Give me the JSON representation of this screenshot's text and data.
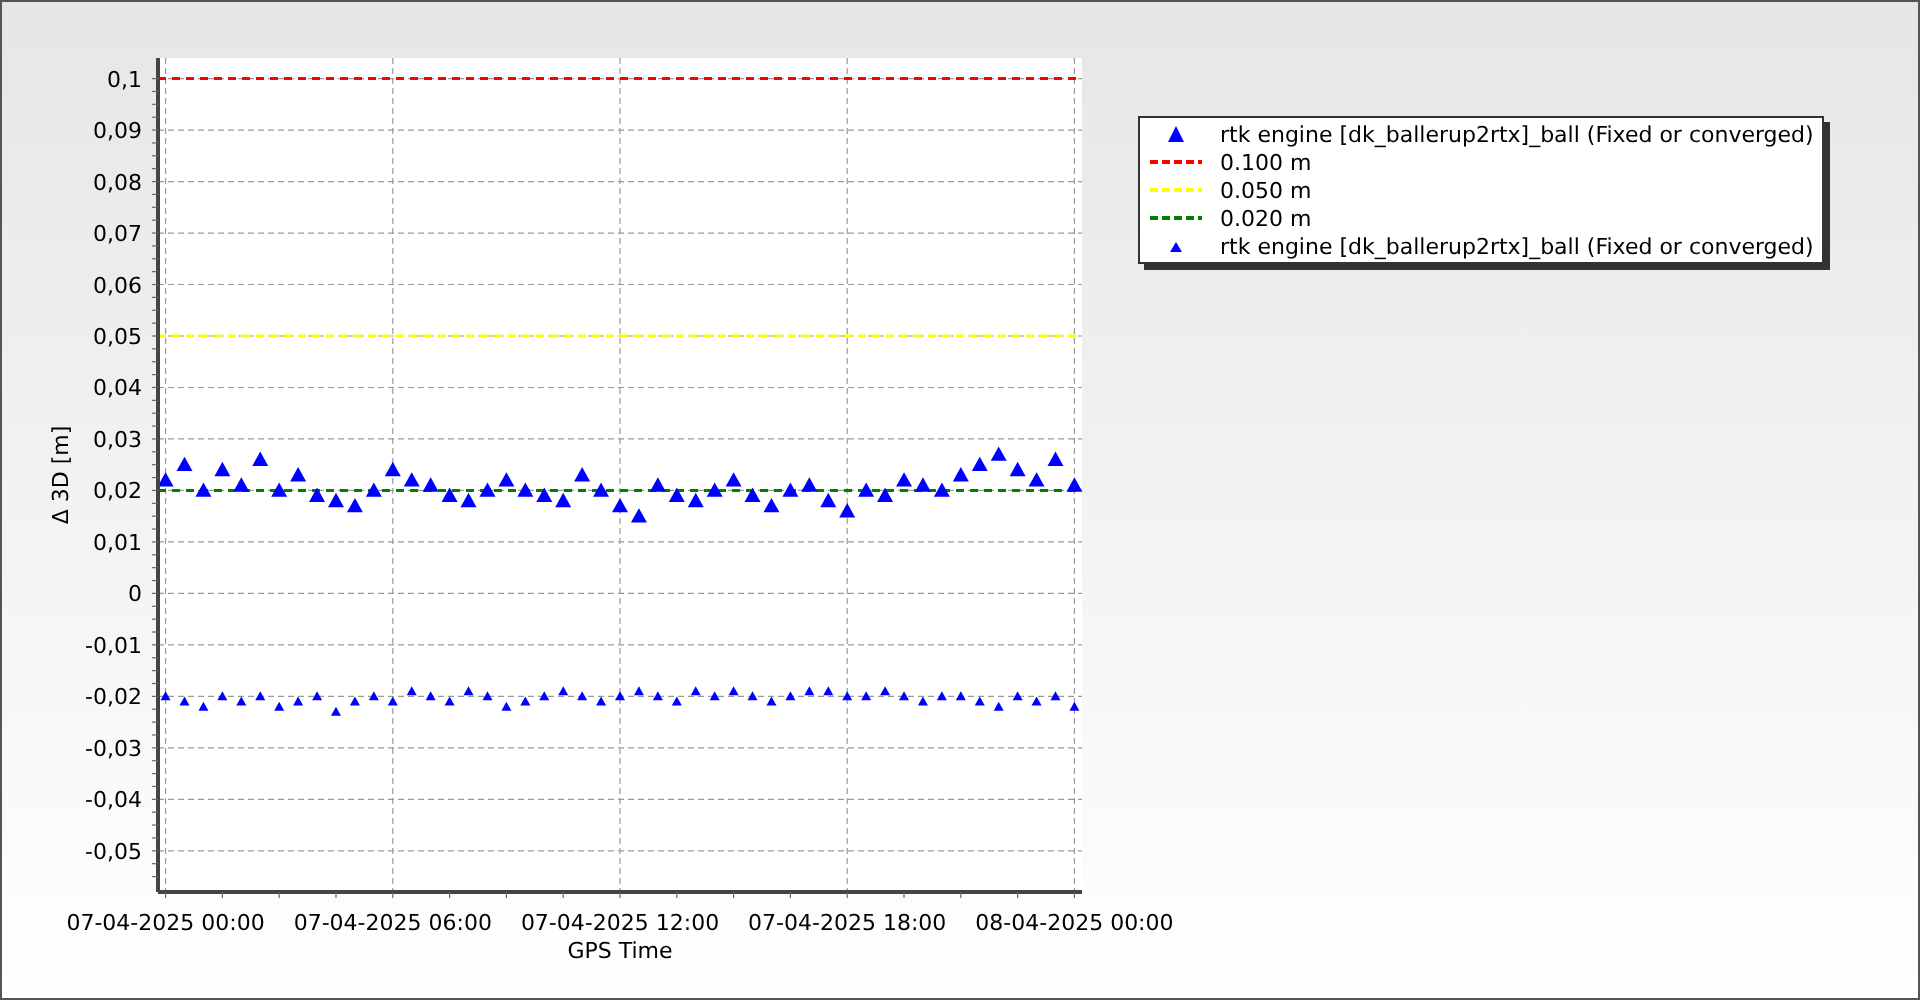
{
  "chart": {
    "chart_data": {
      "type": "scatter",
      "xlabel": "GPS Time",
      "ylabel": "Δ 3D [m]",
      "grid": true,
      "ylim": [
        -0.058,
        0.104
      ],
      "categories": [
        "07-04-2025 00:00",
        null,
        null,
        null,
        null,
        null,
        null,
        null,
        null,
        null,
        null,
        null,
        "07-04-2025 06:00",
        null,
        null,
        null,
        null,
        null,
        null,
        null,
        null,
        null,
        null,
        null,
        "07-04-2025 12:00",
        null,
        null,
        null,
        null,
        null,
        null,
        null,
        null,
        null,
        null,
        null,
        "07-04-2025 18:00",
        null,
        null,
        null,
        null,
        null,
        null,
        null,
        null,
        null,
        null,
        null,
        "08-04-2025 00:00"
      ],
      "yticks": [
        {
          "value": 0.1,
          "label": "0,1"
        },
        {
          "value": 0.09,
          "label": "0,09"
        },
        {
          "value": 0.08,
          "label": "0,08"
        },
        {
          "value": 0.07,
          "label": "0,07"
        },
        {
          "value": 0.06,
          "label": "0,06"
        },
        {
          "value": 0.05,
          "label": "0,05"
        },
        {
          "value": 0.04,
          "label": "0,04"
        },
        {
          "value": 0.03,
          "label": "0,03"
        },
        {
          "value": 0.02,
          "label": "0,02"
        },
        {
          "value": 0.01,
          "label": "0,01"
        },
        {
          "value": 0,
          "label": "0"
        },
        {
          "value": -0.01,
          "label": "-0,01"
        },
        {
          "value": -0.02,
          "label": "-0,02"
        },
        {
          "value": -0.03,
          "label": "-0,03"
        },
        {
          "value": -0.04,
          "label": "-0,04"
        },
        {
          "value": -0.05,
          "label": "-0,05"
        }
      ],
      "series": [
        {
          "name": "rtk engine [dk_ballerup2rtx]_ball (Fixed or converged)",
          "color": "#0000ff",
          "values": [
            0.022,
            0.025,
            0.02,
            0.024,
            0.021,
            0.026,
            0.02,
            0.023,
            0.019,
            0.018,
            0.017,
            0.02,
            0.024,
            0.022,
            0.021,
            0.019,
            0.018,
            0.02,
            0.022,
            0.02,
            0.019,
            0.018,
            0.023,
            0.02,
            0.017,
            0.015,
            0.021,
            0.019,
            0.018,
            0.02,
            0.022,
            0.019,
            0.017,
            0.02,
            0.021,
            0.018,
            0.016,
            0.02,
            0.019,
            0.022,
            0.021,
            0.02,
            0.023,
            0.025,
            0.027,
            0.024,
            0.022,
            0.026,
            0.021
          ]
        },
        {
          "name": "rtk engine [dk_ballerup2rtx]_ball (Fixed or converged)",
          "color": "#0000ff",
          "values": [
            -0.02,
            -0.021,
            -0.022,
            -0.02,
            -0.021,
            -0.02,
            -0.022,
            -0.021,
            -0.02,
            -0.023,
            -0.021,
            -0.02,
            -0.021,
            -0.019,
            -0.02,
            -0.021,
            -0.019,
            -0.02,
            -0.022,
            -0.021,
            -0.02,
            -0.019,
            -0.02,
            -0.021,
            -0.02,
            -0.019,
            -0.02,
            -0.021,
            -0.019,
            -0.02,
            -0.019,
            -0.02,
            -0.021,
            -0.02,
            -0.019,
            -0.019,
            -0.02,
            -0.02,
            -0.019,
            -0.02,
            -0.021,
            -0.02,
            -0.02,
            -0.021,
            -0.022,
            -0.02,
            -0.021,
            -0.02,
            -0.022
          ]
        }
      ],
      "ref_lines": [
        {
          "axis": "y",
          "value": 0.1,
          "label": "0.100 m",
          "color": "#ff0000"
        },
        {
          "axis": "y",
          "value": 0.05,
          "label": "0.050 m",
          "color": "#ffff00"
        },
        {
          "axis": "y",
          "value": 0.02,
          "label": "0.020 m",
          "color": "#008000"
        }
      ]
    }
  }
}
